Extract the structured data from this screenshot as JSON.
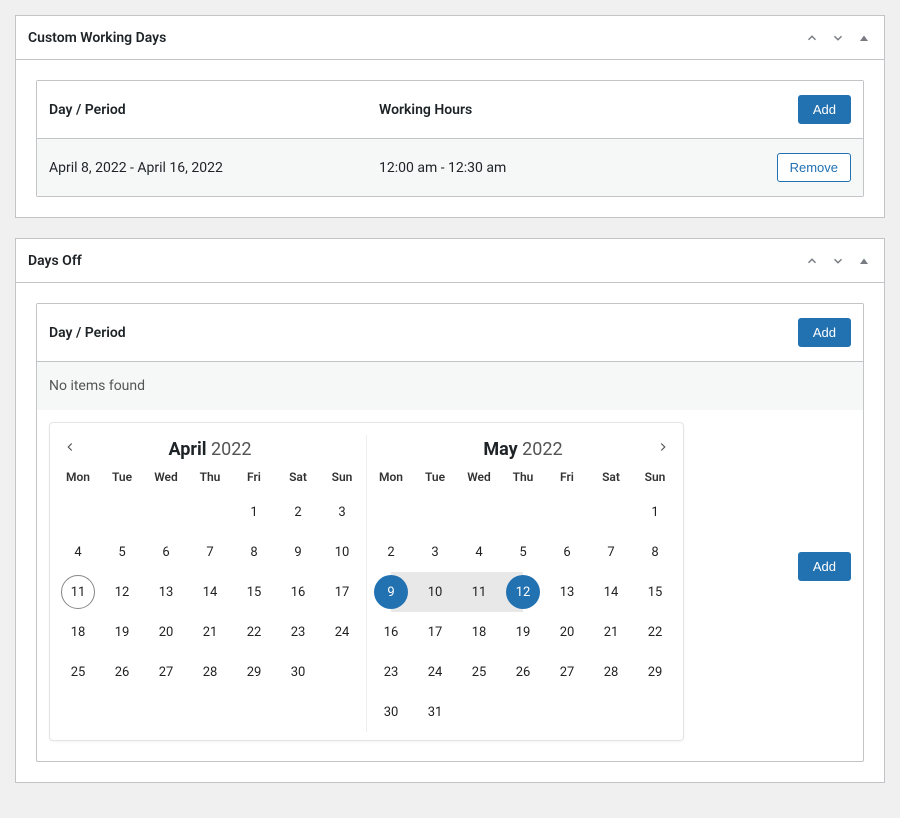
{
  "panel1": {
    "title": "Custom Working Days",
    "headers": {
      "day": "Day / Period",
      "hours": "Working Hours"
    },
    "add_label": "Add",
    "rows": [
      {
        "period": "April 8, 2022 - April 16, 2022",
        "hours": "12:00 am - 12:30 am",
        "remove_label": "Remove"
      }
    ]
  },
  "panel2": {
    "title": "Days Off",
    "headers": {
      "day": "Day / Period"
    },
    "add_label": "Add",
    "no_items": "No items found"
  },
  "calendar": {
    "dow": [
      "Mon",
      "Tue",
      "Wed",
      "Thu",
      "Fri",
      "Sat",
      "Sun"
    ],
    "left": {
      "month": "April",
      "year": "2022",
      "today": 11,
      "weeks": [
        [
          "",
          "",
          "",
          "",
          "1",
          "2",
          "3"
        ],
        [
          "4",
          "5",
          "6",
          "7",
          "8",
          "9",
          "10"
        ],
        [
          "11",
          "12",
          "13",
          "14",
          "15",
          "16",
          "17"
        ],
        [
          "18",
          "19",
          "20",
          "21",
          "22",
          "23",
          "24"
        ],
        [
          "25",
          "26",
          "27",
          "28",
          "29",
          "30",
          ""
        ]
      ]
    },
    "right": {
      "month": "May",
      "year": "2022",
      "sel_start": 9,
      "sel_end": 12,
      "weeks": [
        [
          "",
          "",
          "",
          "",
          "",
          "",
          "1"
        ],
        [
          "2",
          "3",
          "4",
          "5",
          "6",
          "7",
          "8"
        ],
        [
          "9",
          "10",
          "11",
          "12",
          "13",
          "14",
          "15"
        ],
        [
          "16",
          "17",
          "18",
          "19",
          "20",
          "21",
          "22"
        ],
        [
          "23",
          "24",
          "25",
          "26",
          "27",
          "28",
          "29"
        ],
        [
          "30",
          "31",
          "",
          "",
          "",
          "",
          ""
        ]
      ]
    },
    "add_label": "Add"
  }
}
